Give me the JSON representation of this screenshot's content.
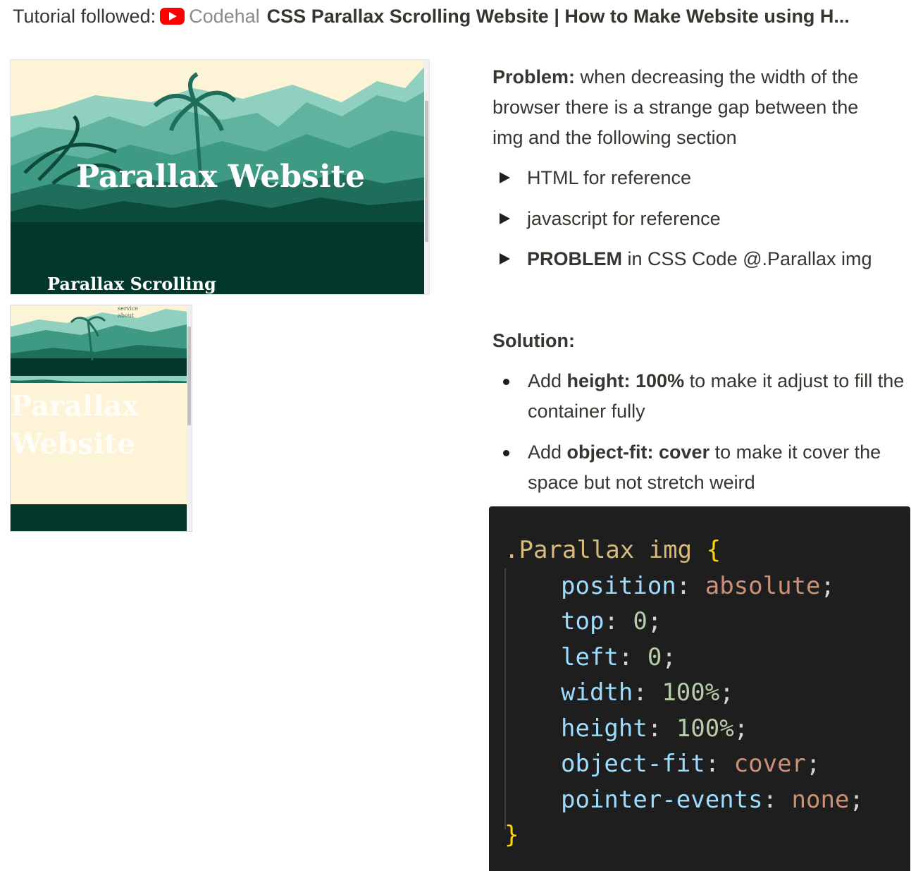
{
  "header": {
    "prefix": "Tutorial followed:",
    "icon": "youtube-icon",
    "channel": "Codehal",
    "video_title": "CSS Parallax Scrolling Website | How to Make Website using H..."
  },
  "screenshot_wide": {
    "title": "Parallax Website",
    "subtitle": "Parallax Scrolling"
  },
  "screenshot_narrow": {
    "nav_items": [
      "service",
      "about"
    ],
    "title_line1": "Parallax",
    "title_line2": "Website"
  },
  "problem": {
    "label": "Problem:",
    "text": " when decreasing the width of the browser there is a strange gap between the img and the following section"
  },
  "toggles": [
    {
      "label": "HTML for reference"
    },
    {
      "label": "javascript for reference"
    },
    {
      "label_bold": "PROBLEM",
      "label_rest": " in CSS Code @.Parallax img"
    }
  ],
  "solution": {
    "heading": "Solution:",
    "bullets": [
      {
        "pre": "Add ",
        "bold": "height: 100%",
        "post": " to make it adjust to fill the container fully"
      },
      {
        "pre": "Add ",
        "bold": "object-fit: cover",
        "post": " to make it cover the space but not stretch weird"
      }
    ]
  },
  "code": {
    "selector": ".Parallax img",
    "open": "{",
    "close": "}",
    "declarations": [
      {
        "prop": "position",
        "value": "absolute",
        "kind": "keyword"
      },
      {
        "prop": "top",
        "value": "0",
        "kind": "number"
      },
      {
        "prop": "left",
        "value": "0",
        "kind": "number"
      },
      {
        "prop": "width",
        "value": "100%",
        "kind": "number"
      },
      {
        "prop": "height",
        "value": "100%",
        "kind": "number"
      },
      {
        "prop": "object-fit",
        "value": "cover",
        "kind": "keyword"
      },
      {
        "prop": "pointer-events",
        "value": "none",
        "kind": "keyword"
      }
    ]
  },
  "colors": {
    "jungle_dark": "#03372a",
    "jungle_mid": "#3f9a84",
    "jungle_light": "#8fd0bf",
    "sky": "#fdf3d6",
    "code_bg": "#1e1e1e"
  }
}
